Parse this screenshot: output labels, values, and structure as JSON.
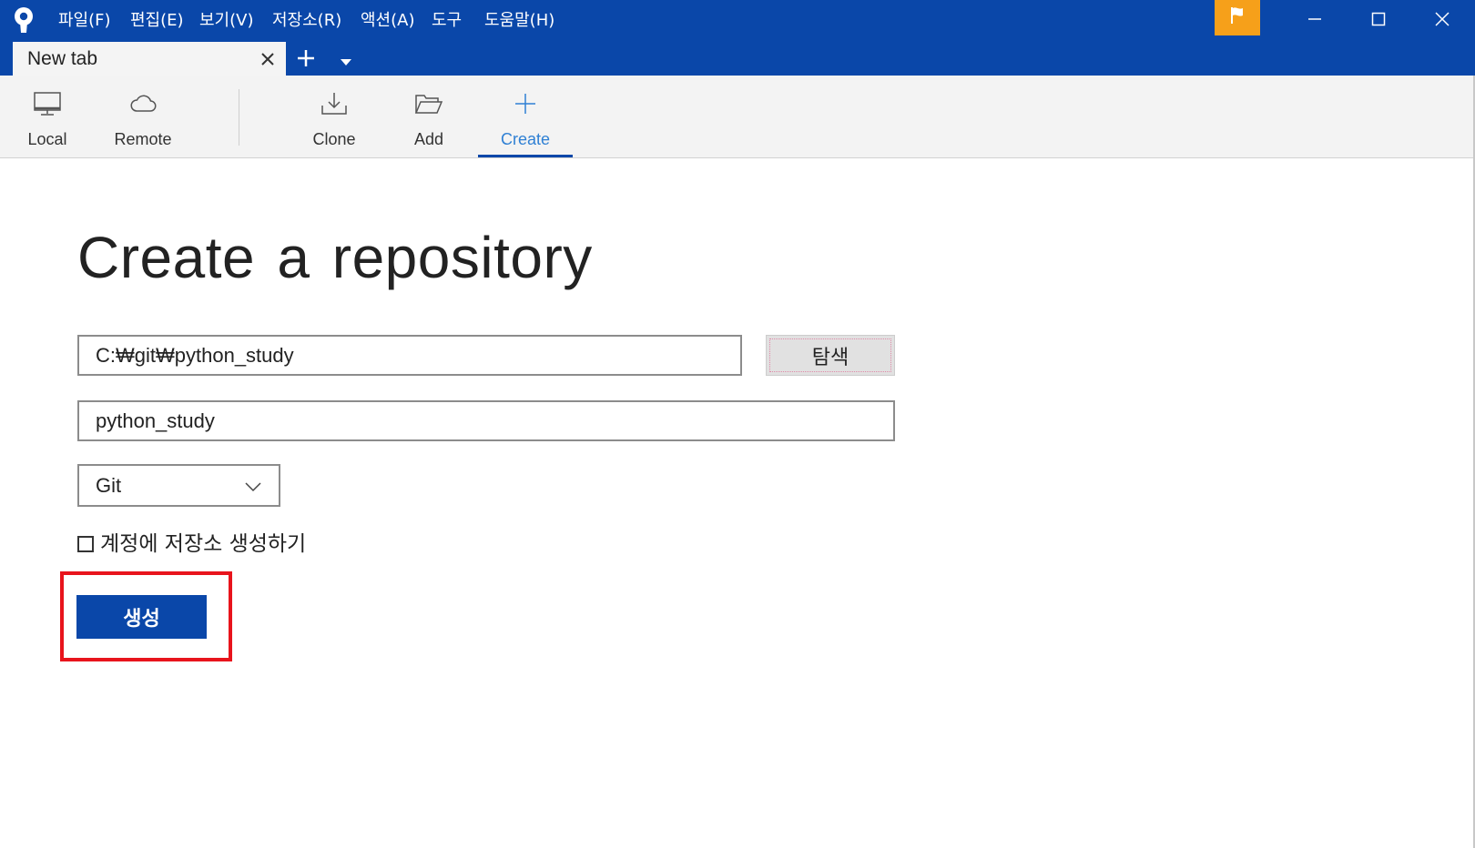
{
  "window": {
    "logo_icon": "sourcetree-logo-icon",
    "menu": [
      "파일(F)",
      "편집(E)",
      "보기(V)",
      "저장소(R)",
      "액션(A)",
      "도구",
      "도움말(H)"
    ],
    "controls": {
      "flag_icon": "flag-icon",
      "minimize_icon": "minimize-icon",
      "maximize_icon": "maximize-icon",
      "close_icon": "close-icon"
    }
  },
  "tabs": {
    "items": [
      {
        "label": "New tab",
        "close_icon": "close-icon"
      }
    ],
    "new_tab_icon": "plus-icon",
    "dropdown_icon": "caret-down-icon"
  },
  "toolbar": {
    "items": [
      {
        "label": "Local",
        "icon": "monitor-icon",
        "selected": false
      },
      {
        "label": "Remote",
        "icon": "cloud-icon",
        "selected": false
      },
      {
        "label": "Clone",
        "icon": "download-icon",
        "selected": false
      },
      {
        "label": "Add",
        "icon": "folder-open-icon",
        "selected": false
      },
      {
        "label": "Create",
        "icon": "plus-icon",
        "selected": true
      }
    ]
  },
  "form": {
    "title": "Create a repository",
    "path_value": "C:₩git₩python_study",
    "browse_label": "탐색",
    "name_value": "python_study",
    "vcs_selected": "Git",
    "create_remote_label": "계정에 저장소 생성하기",
    "create_remote_checked": false,
    "submit_label": "생성"
  },
  "colors": {
    "titlebar": "#0a47a9",
    "accent": "#2f80d4",
    "flag_button": "#f6a01a",
    "highlight_box": "#e8141c",
    "primary_button": "#0a47a9"
  }
}
